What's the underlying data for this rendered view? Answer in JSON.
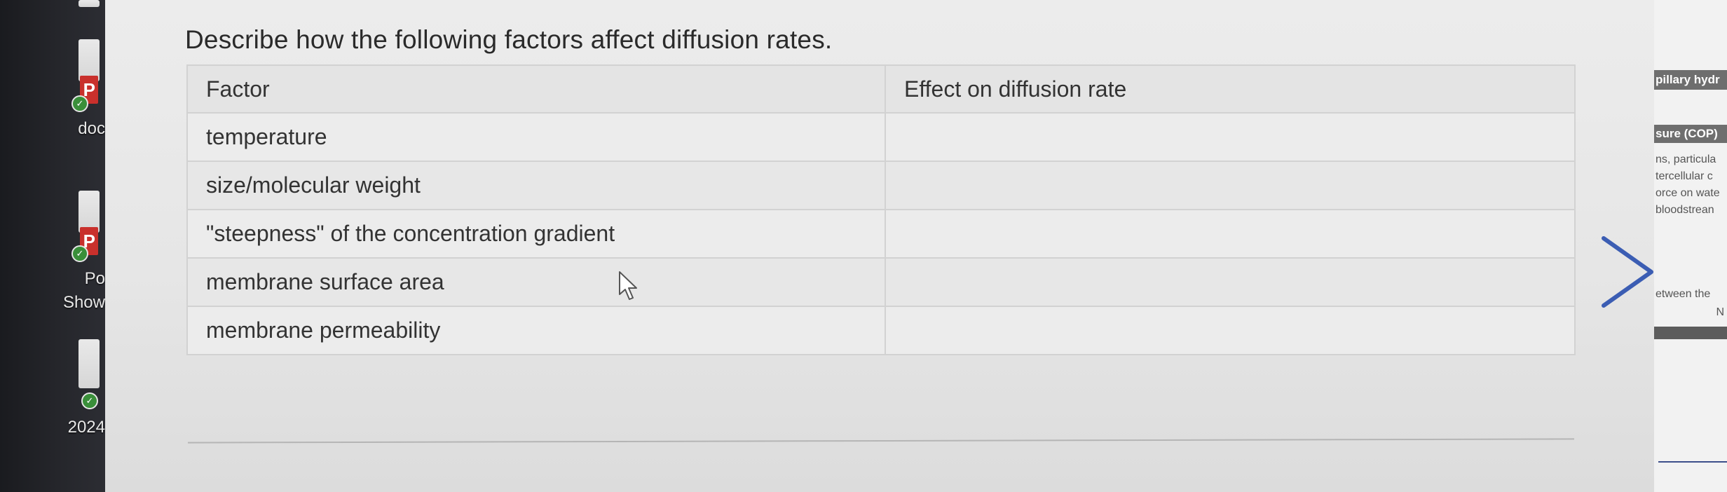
{
  "desktop": {
    "labels": [
      "doc",
      "Po",
      "Show",
      "2024"
    ],
    "badge_letter": "P"
  },
  "question": {
    "title": "Describe how the following factors affect diffusion rates."
  },
  "table": {
    "headers": [
      "Factor",
      "Effect on diffusion rate"
    ],
    "rows": [
      "temperature",
      "size/molecular weight",
      "\"steepness\" of the concentration gradient",
      "membrane surface area",
      "membrane permeability"
    ]
  },
  "right_panel": {
    "band_1": "pillary hydr",
    "band_2": "sure (COP)",
    "lines": [
      "ns, particula",
      "tercellular c",
      "orce on wate",
      "bloodstrean"
    ],
    "line_2": [
      "etween the",
      "N"
    ]
  },
  "colors": {
    "arrow": "#3b5db3",
    "page_bg": "#e8e8e8",
    "text": "#333333"
  },
  "icons": {
    "next": "chevron-right-icon",
    "cursor": "mouse-pointer-icon"
  }
}
